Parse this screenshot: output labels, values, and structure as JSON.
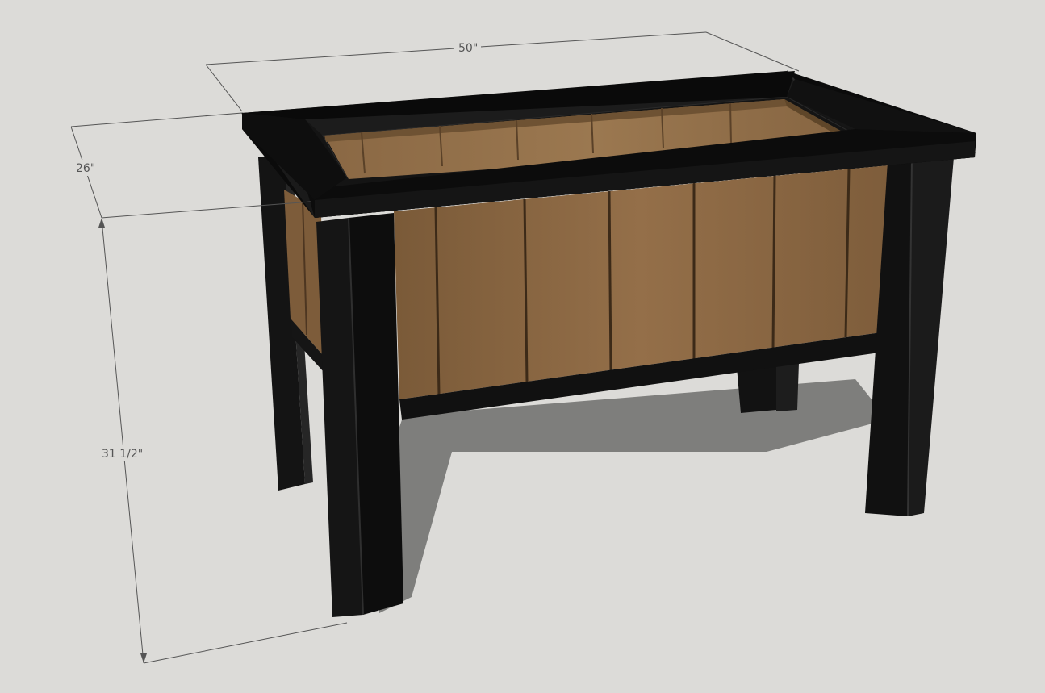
{
  "canvas": {
    "background_color": "#dcdbd8"
  },
  "model": {
    "frame_color": "#0e0e0e",
    "panel_color": "#8b6a45",
    "shadow_color": "#7e7e7c",
    "dimension_line_color": "#555555"
  },
  "dimensions": {
    "width_label": "50\"",
    "depth_label": "26\"",
    "height_label": "31 1/2\""
  }
}
